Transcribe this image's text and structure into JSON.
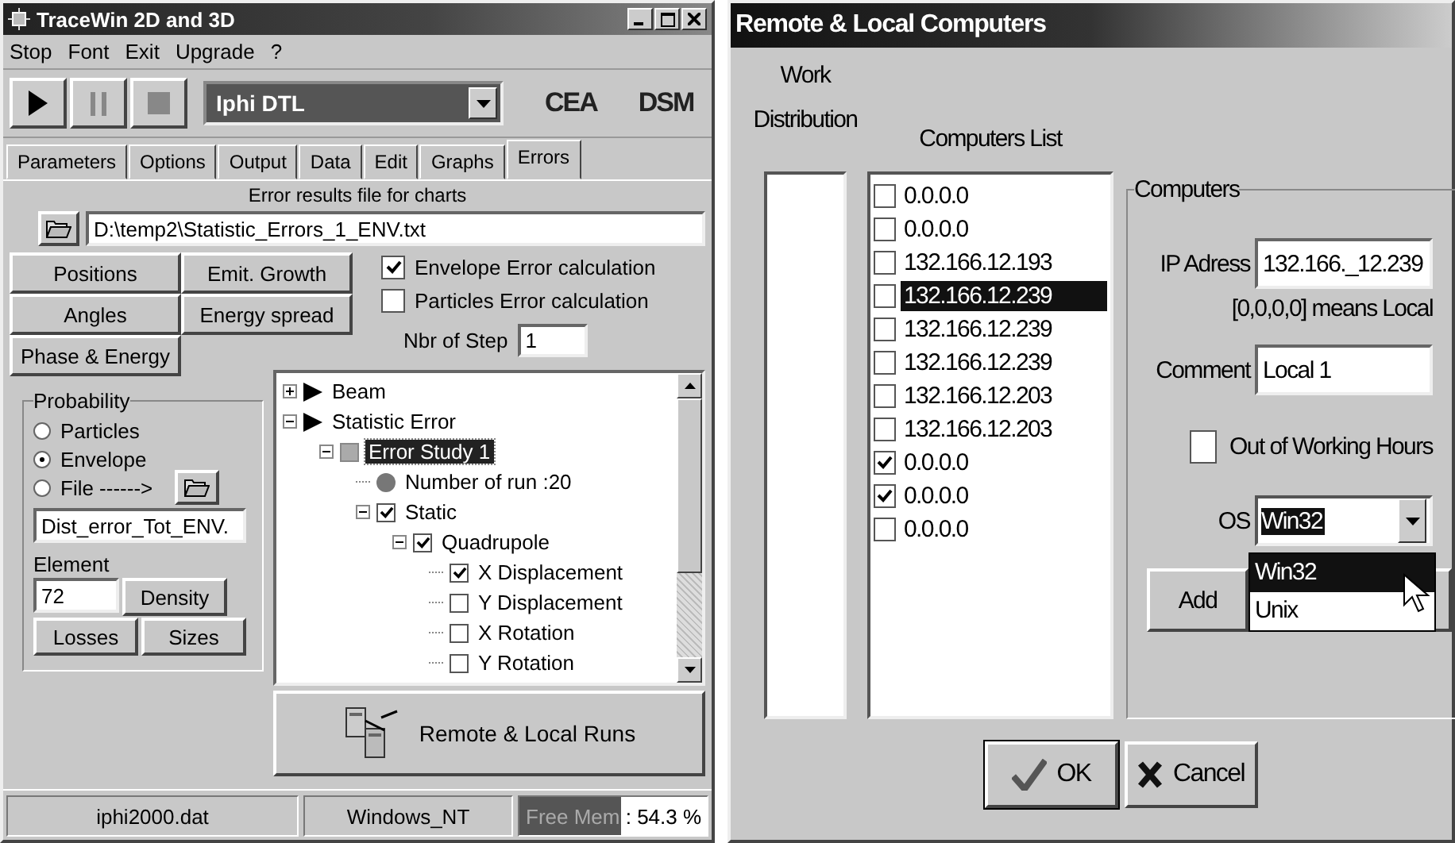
{
  "main_window": {
    "title": "TraceWin 2D and 3D",
    "menu": [
      "Stop",
      "Font",
      "Exit",
      "Upgrade",
      "?"
    ],
    "toolbar": {
      "project": "Iphi DTL",
      "logos": [
        "CEA",
        "DSM"
      ]
    },
    "tabs": [
      {
        "label": "Parameters",
        "selected": false
      },
      {
        "label": "Options",
        "selected": false
      },
      {
        "label": "Output",
        "selected": false
      },
      {
        "label": "Data",
        "selected": false
      },
      {
        "label": "Edit",
        "selected": false
      },
      {
        "label": "Graphs",
        "selected": false
      },
      {
        "label": "Errors",
        "selected": true
      }
    ],
    "errors_tab": {
      "file_label": "Error results file for charts",
      "file_path": "D:\\temp2\\Statistic_Errors_1_ENV.txt",
      "chart_buttons": [
        "Positions",
        "Emit. Growth",
        "Angles",
        "Energy spread",
        "Phase & Energy"
      ],
      "options": [
        {
          "label": "Envelope Error calculation",
          "checked": true
        },
        {
          "label": "Particles Error calculation",
          "checked": false
        }
      ],
      "step_label": "Nbr of Step",
      "step_value": "1",
      "probability": {
        "title": "Probability",
        "choices": [
          {
            "label": "Particles",
            "selected": false
          },
          {
            "label": "Envelope",
            "selected": true
          },
          {
            "label": "File ------>",
            "selected": false
          }
        ],
        "file_value": "Dist_error_Tot_ENV.",
        "element_label": "Element",
        "element_value": "72",
        "buttons": [
          "Density",
          "Losses",
          "Sizes"
        ]
      },
      "tree": [
        {
          "label": "Beam",
          "kind": "arrow",
          "expanded": false
        },
        {
          "label": "Statistic Error",
          "kind": "arrow",
          "expanded": true,
          "children": [
            {
              "label": "Error Study 1",
              "kind": "square",
              "expanded": true,
              "selected": true,
              "children": [
                {
                  "label": "Number of run :20",
                  "kind": "dot"
                },
                {
                  "label": "Static",
                  "kind": "check",
                  "checked": true,
                  "expanded": true,
                  "children": [
                    {
                      "label": "Quadrupole",
                      "kind": "check",
                      "checked": true,
                      "expanded": true,
                      "children": [
                        {
                          "label": "X Displacement",
                          "kind": "check",
                          "checked": true
                        },
                        {
                          "label": "Y Displacement",
                          "kind": "check",
                          "checked": false
                        },
                        {
                          "label": "X Rotation",
                          "kind": "check",
                          "checked": false
                        },
                        {
                          "label": "Y Rotation",
                          "kind": "check",
                          "checked": false
                        }
                      ]
                    }
                  ]
                }
              ]
            }
          ]
        }
      ],
      "run_button": "Remote & Local Runs"
    },
    "status_bar": {
      "file": "iphi2000.dat",
      "os": "Windows_NT",
      "memory": {
        "text": "Free Mem : 54.3 %",
        "level": 0.543
      }
    }
  },
  "remote_dialog": {
    "title": "Remote & Local Computers",
    "work_label": "Work Distribution",
    "list_label": "Computers List",
    "computers": [
      {
        "address": "0.0.0.0",
        "checked": false,
        "selected": false
      },
      {
        "address": "0.0.0.0",
        "checked": false,
        "selected": false
      },
      {
        "address": "132.166.12.193",
        "checked": false,
        "selected": false
      },
      {
        "address": "132.166.12.239",
        "checked": false,
        "selected": true
      },
      {
        "address": "132.166.12.239",
        "checked": false,
        "selected": false
      },
      {
        "address": "132.166.12.239",
        "checked": false,
        "selected": false
      },
      {
        "address": "132.166.12.203",
        "checked": false,
        "selected": false
      },
      {
        "address": "132.166.12.203",
        "checked": false,
        "selected": false
      },
      {
        "address": "0.0.0.0",
        "checked": true,
        "selected": false
      },
      {
        "address": "0.0.0.0",
        "checked": true,
        "selected": false
      },
      {
        "address": "0.0.0.0",
        "checked": false,
        "selected": false
      }
    ],
    "group": {
      "title": "Computers",
      "ip_label": "IP Adress",
      "ip_value": "132.166._12.239",
      "ip_hint": "[0,0,0,0] means Local",
      "comment_label": "Comment",
      "comment_value": "Local 1",
      "out_of_hours": {
        "label": "Out of Working Hours",
        "checked": false
      },
      "os_label": "OS",
      "os_value": "Win32",
      "os_options": [
        {
          "label": "Win32",
          "selected": true
        },
        {
          "label": "Unix",
          "selected": false
        }
      ],
      "buttons": [
        "Add"
      ]
    },
    "ok": "OK",
    "cancel": "Cancel"
  }
}
